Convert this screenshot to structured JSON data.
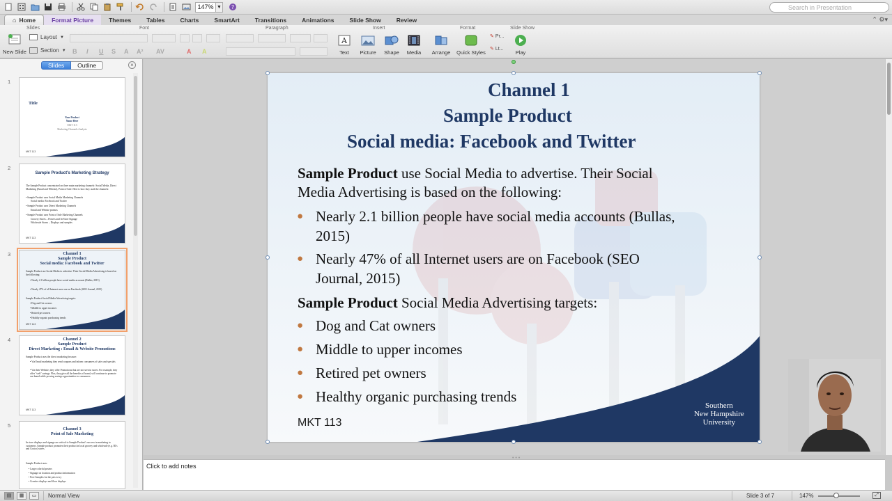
{
  "qat": {
    "zoom": "147%"
  },
  "search": {
    "placeholder": "Search in Presentation"
  },
  "tabs": [
    "Home",
    "Format Picture",
    "Themes",
    "Tables",
    "Charts",
    "SmartArt",
    "Transitions",
    "Animations",
    "Slide Show",
    "Review"
  ],
  "ribbon": {
    "groups": {
      "slides": "Slides",
      "font": "Font",
      "paragraph": "Paragraph",
      "insert": "Insert",
      "format": "Format",
      "slideshow": "Slide Show"
    },
    "new_slide": "New Slide",
    "layout": "Layout",
    "section": "Section",
    "text": "Text",
    "picture": "Picture",
    "shape": "Shape",
    "media": "Media",
    "arrange": "Arrange",
    "quick_styles": "Quick Styles",
    "play": "Play",
    "style_a": "Pr...",
    "style_b": "Lt..."
  },
  "panel": {
    "slides_tab": "Slides",
    "outline_tab": "Outline"
  },
  "thumbnails": [
    {
      "num": "1",
      "title": "Title",
      "lines": [
        "Your Product",
        "Name Here",
        "MKT 113",
        "Marketing Channels Analysis"
      ],
      "footer": "MKT 113"
    },
    {
      "num": "2",
      "title": "Sample Product's Marketing Strategy",
      "lines": [
        "The Sample Product concentrated on three main marketing channels: Social Media, Direct Marketing (Email and Website), Point of Sale. Here is how they used the channels:",
        "• Sample Product uses Social Media Marketing Channels",
        "   Social media: Facebook and Twitter",
        "• Sample Product uses Direct Marketing Channels",
        "   Email and Website promos",
        "• Sample Product uses Point of Sale Marketing Channels",
        "   Grocery Stores – Posters and In-Store Signage",
        "   Wholesale Stores – Displays and samples"
      ],
      "footer": "MKT 113"
    },
    {
      "num": "3",
      "title": "Channel 1\nSample Product\nSocial media: Facebook and Twitter",
      "lines": [
        "Sample Product use Social Media to advertise. Their Social Media Advertising is based on the following:",
        "• Nearly 2.1 billion people have social media accounts (Bullas, 2015)",
        "• Nearly 47% of all Internet users are on Facebook (SEO Journal, 2015)",
        "Sample Product Social Media Advertising targets:",
        "• Dog and Cat owners",
        "• Middle to upper incomes",
        "• Retired pet owners",
        "• Healthy organic purchasing trends"
      ],
      "footer": "MKT 113"
    },
    {
      "num": "4",
      "title": "Channel 2\nSample Product\nDirect Marketing : Email & Website Promotions",
      "lines": [
        "Sample Product uses the direct marketing because:",
        "• Via Email marketing they send coupons and inform consumers of sales and specials",
        "• Via their Website, they offer Promotions that are not seen in stores. For example, they offer \"web\" savings. Plus, they give all the benefits of brand, will continue to promote our brand while proving savings opportunities to consumers."
      ],
      "footer": "MKT 113"
    },
    {
      "num": "5",
      "title": "Channel 3\nPoint of Sale Marketing",
      "lines": [
        "In store displays and signage are critical to Sample Product's success in marketing to customers. Sample product promotes their product in local grocery and wholesale (e.g. BJ's and Costco) stores.",
        "",
        "Sample Product uses:",
        "• Large colorful posters",
        "• Signage on location and product information",
        "• Free Samples for the pets to try",
        "• Creative displays and floor displays"
      ],
      "footer": ""
    }
  ],
  "slide": {
    "title_lines": [
      "Channel 1",
      "Sample Product",
      "Social media: Facebook and Twitter"
    ],
    "intro_bold": "Sample Product",
    "intro_rest": " use Social Media to advertise. Their Social",
    "intro_line2": "Media Advertising is based on the following:",
    "bullets1": [
      [
        "Nearly 2.1 billion people have social media accounts (Bullas,",
        "2015)"
      ],
      [
        "Nearly 47% of all Internet users are on Facebook (SEO",
        "Journal, 2015)"
      ]
    ],
    "targets_bold": "Sample Product",
    "targets_rest": " Social Media Advertising targets:",
    "bullets2": [
      "Dog and Cat owners",
      "Middle to upper incomes",
      "Retired pet owners",
      "Healthy organic purchasing trends"
    ],
    "footer": "MKT 113",
    "logo_lines": [
      "Southern",
      "New Hampshire",
      "University"
    ]
  },
  "notes": {
    "placeholder": "Click to add notes"
  },
  "status": {
    "view": "Normal View",
    "slide_counter": "Slide 3 of 7",
    "zoom": "147%"
  },
  "colors": {
    "navy": "#1f3864",
    "bullet": "#c07840",
    "selection": "#f2a06b",
    "segment_blue": "#3c7fd9"
  }
}
